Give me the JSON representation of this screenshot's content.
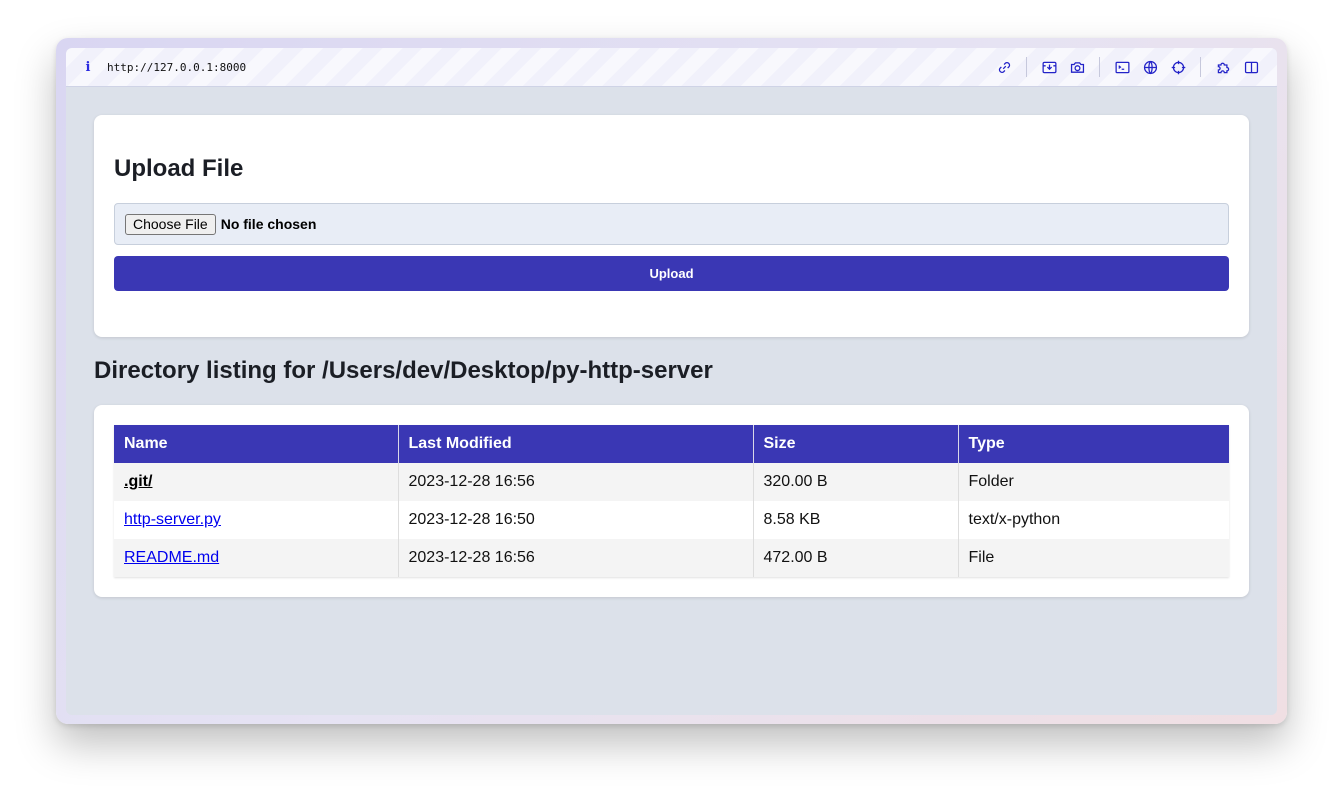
{
  "browser": {
    "url": "http://127.0.0.1:8000",
    "info_icon": "i",
    "toolbar_icons": [
      "link-icon",
      "download-icon",
      "camera-icon",
      "terminal-icon",
      "globe-icon",
      "crosshair-icon",
      "extension-icon",
      "sidebar-icon"
    ]
  },
  "upload": {
    "title": "Upload File",
    "choose_label": "Choose File",
    "no_file_text": "No file chosen",
    "button_label": "Upload"
  },
  "listing": {
    "title": "Directory listing for /Users/dev/Desktop/py-http-server",
    "columns": [
      "Name",
      "Last Modified",
      "Size",
      "Type"
    ],
    "rows": [
      {
        "name": ".git/",
        "modified": "2023-12-28 16:56",
        "size": "320.00 B",
        "type": "Folder"
      },
      {
        "name": "http-server.py",
        "modified": "2023-12-28 16:50",
        "size": "8.58 KB",
        "type": "text/x-python"
      },
      {
        "name": "README.md",
        "modified": "2023-12-28 16:56",
        "size": "472.00 B",
        "type": "File"
      }
    ]
  },
  "colors": {
    "accent": "#3a37b4",
    "page_bg": "#dce1ea",
    "link": "#0000ee"
  }
}
